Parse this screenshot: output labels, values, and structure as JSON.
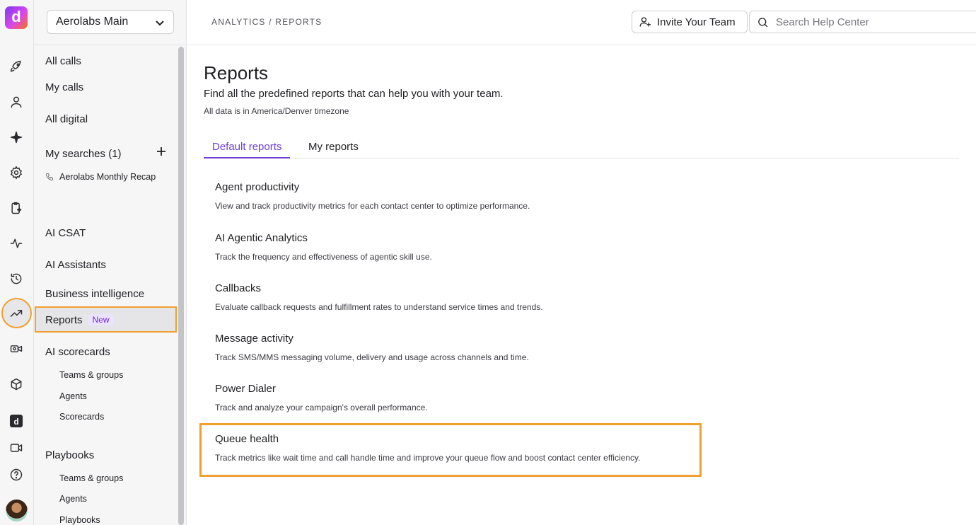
{
  "sidebar": {
    "workspace": "Aerolabs Main",
    "nav": {
      "all_calls": "All calls",
      "my_calls": "My calls",
      "all_digital": "All digital",
      "my_searches": "My searches (1)",
      "saved_search": "Aerolabs Monthly Recap",
      "ai_csat": "AI CSAT",
      "ai_assistants": "AI Assistants",
      "business_intelligence": "Business intelligence",
      "reports": "Reports",
      "reports_badge": "New",
      "ai_scorecards": "AI scorecards",
      "scorecards_teams": "Teams & groups",
      "scorecards_agents": "Agents",
      "scorecards_scorecards": "Scorecards",
      "playbooks": "Playbooks",
      "playbooks_teams": "Teams & groups",
      "playbooks_agents": "Agents",
      "playbooks_playbooks": "Playbooks"
    }
  },
  "rail": {
    "logo_letter": "d",
    "icons": [
      "rocket-icon",
      "person-icon",
      "sparkle-icon",
      "gear-icon",
      "clipboard-sparkle-icon",
      "activity-icon",
      "history-icon",
      "trending-up-icon",
      "video-settings-icon",
      "cube-icon",
      "app-logo-icon",
      "video-icon",
      "help-icon"
    ]
  },
  "header": {
    "breadcrumb": "ANALYTICS / REPORTS",
    "invite_label": "Invite Your Team",
    "search_placeholder": "Search Help Center"
  },
  "main": {
    "title": "Reports",
    "subtitle": "Find all the predefined reports that can help you with your team.",
    "timezone_note": "All data is in America/Denver timezone",
    "tabs": [
      {
        "label": "Default reports",
        "active": true
      },
      {
        "label": "My reports",
        "active": false
      }
    ],
    "reports": [
      {
        "name": "Agent productivity",
        "description": "View and track productivity metrics for each contact center to optimize performance."
      },
      {
        "name": "AI Agentic Analytics",
        "description": "Track the frequency and effectiveness of agentic skill use."
      },
      {
        "name": "Callbacks",
        "description": "Evaluate callback requests and fulfillment rates to understand service times and trends."
      },
      {
        "name": "Message activity",
        "description": "Track SMS/MMS messaging volume, delivery and usage across channels and time."
      },
      {
        "name": "Power Dialer",
        "description": "Track and analyze your campaign's overall performance."
      },
      {
        "name": "Queue health",
        "description": "Track metrics like wait time and call handle time and improve your queue flow and boost contact center efficiency."
      }
    ]
  },
  "colors": {
    "accent": "#6d3fd8",
    "highlight": "#f0a030"
  }
}
